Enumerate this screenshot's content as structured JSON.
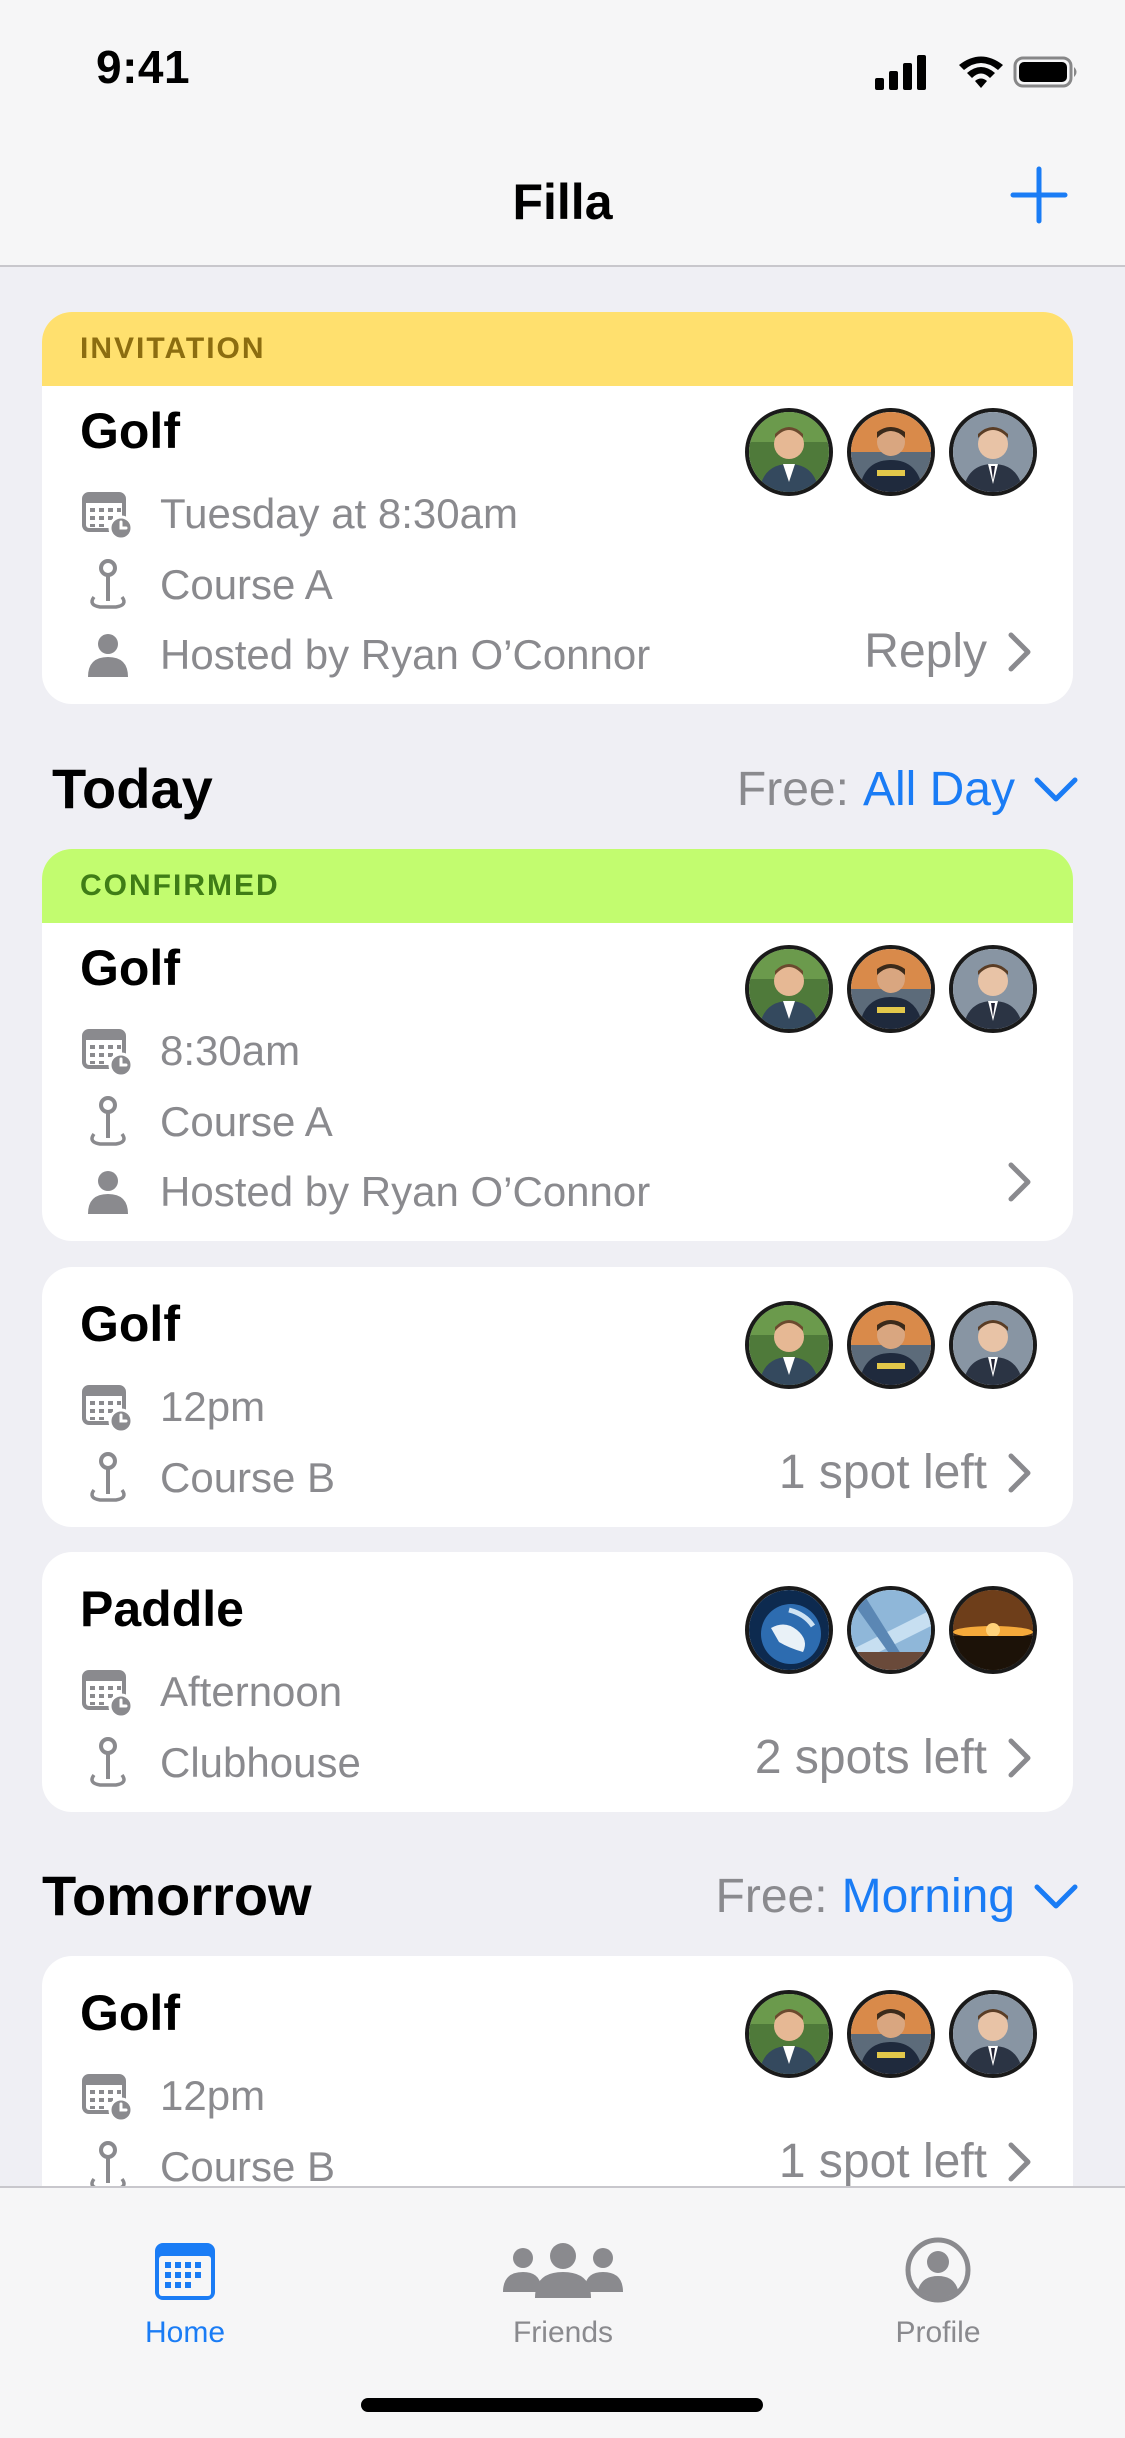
{
  "status_bar": {
    "time": "9:41"
  },
  "nav": {
    "title": "Filla",
    "add_icon": "plus-icon"
  },
  "invitation": {
    "banner": "INVITATION",
    "title": "Golf",
    "time": "Tuesday at 8:30am",
    "location": "Course A",
    "host": "Hosted by Ryan O’Connor",
    "action": "Reply"
  },
  "today": {
    "title": "Today",
    "free_label": "Free:",
    "free_value": "All Day",
    "events": [
      {
        "banner": "CONFIRMED",
        "title": "Golf",
        "time": "8:30am",
        "location": "Course A",
        "host": "Hosted by Ryan O’Connor",
        "action": ""
      },
      {
        "title": "Golf",
        "time": "12pm",
        "location": "Course B",
        "action": "1 spot left"
      },
      {
        "title": "Paddle",
        "time": "Afternoon",
        "location": "Clubhouse",
        "action": "2 spots left"
      }
    ]
  },
  "tomorrow": {
    "title": "Tomorrow",
    "free_label": "Free:",
    "free_value": "Morning",
    "events": [
      {
        "title": "Golf",
        "time": "12pm",
        "location": "Course B",
        "action": "1 spot left"
      }
    ]
  },
  "tabbar": {
    "items": [
      {
        "label": "Home",
        "icon": "calendar-icon",
        "active": true
      },
      {
        "label": "Friends",
        "icon": "people-icon",
        "active": false
      },
      {
        "label": "Profile",
        "icon": "person-circle-icon",
        "active": false
      }
    ]
  },
  "colors": {
    "accent": "#1a7cf5",
    "invitation_banner": "#ffe06e",
    "confirmed_banner": "#c2fc6f",
    "secondary_text": "#8a8a8e"
  }
}
